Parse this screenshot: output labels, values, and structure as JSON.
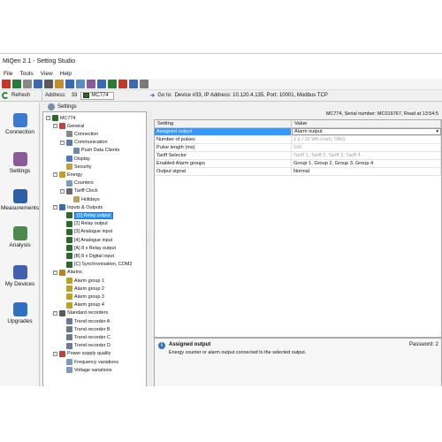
{
  "app": {
    "title": "MiQen 2.1 - Setting Studio"
  },
  "menu": [
    "File",
    "Tools",
    "View",
    "Help"
  ],
  "address_bar": {
    "refresh_label": "Refresh",
    "address_label": "Address:",
    "address_value": "33",
    "device": "MC774",
    "goto_label": "Go to:",
    "goto_target": "Device #33, IP Address: 10.120.4.135, Port: 10001, Modbus TCP"
  },
  "nav": [
    {
      "label": "Connection",
      "icon": "connection-icon",
      "color": "#3b7ad0"
    },
    {
      "label": "Settings",
      "icon": "settings-icon",
      "color": "#8a5a9a"
    },
    {
      "label": "Measurements",
      "icon": "measurements-icon",
      "color": "#2c5fa6"
    },
    {
      "label": "Analysis",
      "icon": "analysis-icon",
      "color": "#4a8a4a"
    },
    {
      "label": "My Devices",
      "icon": "my-devices-icon",
      "color": "#4060b0"
    },
    {
      "label": "Upgrades",
      "icon": "upgrades-icon",
      "color": "#3070c0"
    }
  ],
  "content": {
    "header": "Settings",
    "serial": "MC774, Serial number: MC016767, Read at 13:54:5"
  },
  "tree": [
    {
      "label": "MC774",
      "depth": 0,
      "expander": "-",
      "icon": "device-icon",
      "color": "#2c6a2a"
    },
    {
      "label": "General",
      "depth": 1,
      "expander": "-",
      "icon": "general-icon",
      "color": "#c04040"
    },
    {
      "label": "Connection",
      "depth": 2,
      "expander": "",
      "icon": "connection-icon",
      "color": "#888888"
    },
    {
      "label": "Communication",
      "depth": 2,
      "expander": "-",
      "icon": "communication-icon",
      "color": "#5a7ab0"
    },
    {
      "label": "Push Data Clients",
      "depth": 3,
      "expander": "",
      "icon": "push-data-icon",
      "color": "#6a8ab0"
    },
    {
      "label": "Display",
      "depth": 2,
      "expander": "",
      "icon": "display-icon",
      "color": "#4a7ac0"
    },
    {
      "label": "Security",
      "depth": 2,
      "expander": "",
      "icon": "security-icon",
      "color": "#c0a040"
    },
    {
      "label": "Energy",
      "depth": 1,
      "expander": "-",
      "icon": "energy-icon",
      "color": "#c0a020"
    },
    {
      "label": "Counters",
      "depth": 2,
      "expander": "",
      "icon": "counters-icon",
      "color": "#7a9ac0"
    },
    {
      "label": "Tariff Clock",
      "depth": 2,
      "expander": "-",
      "icon": "tariff-clock-icon",
      "color": "#6a6a6a"
    },
    {
      "label": "Holidays",
      "depth": 3,
      "expander": "",
      "icon": "holidays-icon",
      "color": "#c0a060"
    },
    {
      "label": "Inputs & Outputs",
      "depth": 1,
      "expander": "-",
      "icon": "io-icon",
      "color": "#3a6ab0"
    },
    {
      "label": "[1] Relay output",
      "depth": 2,
      "expander": "",
      "icon": "relay-icon",
      "color": "#2c6a2a",
      "selected": true
    },
    {
      "label": "[2] Relay output",
      "depth": 2,
      "expander": "",
      "icon": "relay-icon",
      "color": "#2c6a2a"
    },
    {
      "label": "[3] Analogue input",
      "depth": 2,
      "expander": "",
      "icon": "analogue-icon",
      "color": "#2c6a2a"
    },
    {
      "label": "[4] Analogue input",
      "depth": 2,
      "expander": "",
      "icon": "analogue-icon",
      "color": "#2c6a2a"
    },
    {
      "label": "[A] 8 x Relay output",
      "depth": 2,
      "expander": "",
      "icon": "relay-icon",
      "color": "#2c6a2a"
    },
    {
      "label": "[B] 8 x Digital input",
      "depth": 2,
      "expander": "",
      "icon": "digital-icon",
      "color": "#2c6a2a"
    },
    {
      "label": "[C] Synchronisation, COM2",
      "depth": 2,
      "expander": "",
      "icon": "sync-icon",
      "color": "#2c6a2a"
    },
    {
      "label": "Alarms",
      "depth": 1,
      "expander": "-",
      "icon": "alarms-icon",
      "color": "#c08020"
    },
    {
      "label": "Alarm group 1",
      "depth": 2,
      "expander": "",
      "icon": "alarm-icon",
      "color": "#c0a020"
    },
    {
      "label": "Alarm group 2",
      "depth": 2,
      "expander": "",
      "icon": "alarm-icon",
      "color": "#c0a020"
    },
    {
      "label": "Alarm group 3",
      "depth": 2,
      "expander": "",
      "icon": "alarm-icon",
      "color": "#c0a020"
    },
    {
      "label": "Alarm group 4",
      "depth": 2,
      "expander": "",
      "icon": "alarm-icon",
      "color": "#c0a020"
    },
    {
      "label": "Standard recorders",
      "depth": 1,
      "expander": "-",
      "icon": "recorders-icon",
      "color": "#5a5a5a"
    },
    {
      "label": "Trend recorder A",
      "depth": 2,
      "expander": "",
      "icon": "trend-icon",
      "color": "#6a7a9a"
    },
    {
      "label": "Trend recorder B",
      "depth": 2,
      "expander": "",
      "icon": "trend-icon",
      "color": "#6a7a9a"
    },
    {
      "label": "Trend recorder C",
      "depth": 2,
      "expander": "",
      "icon": "trend-icon",
      "color": "#6a7a9a"
    },
    {
      "label": "Trend recorder D",
      "depth": 2,
      "expander": "",
      "icon": "trend-icon",
      "color": "#6a7a9a"
    },
    {
      "label": "Power supply quality",
      "depth": 1,
      "expander": "-",
      "icon": "power-quality-icon",
      "color": "#c04040"
    },
    {
      "label": "Frequency variations",
      "depth": 2,
      "expander": "",
      "icon": "frequency-icon",
      "color": "#7a9ac0"
    },
    {
      "label": "Voltage variations",
      "depth": 2,
      "expander": "",
      "icon": "voltage-icon",
      "color": "#7a9ac0"
    }
  ],
  "grid": {
    "headers": [
      "Setting",
      "Value"
    ],
    "rows": [
      {
        "setting": "Assigned output",
        "value": "Alarm output",
        "selected": true,
        "dropdown": true
      },
      {
        "setting": "Number of pulses",
        "value": "1 p / 10 Wh (varh, VAh)",
        "grey": true
      },
      {
        "setting": "Pulse length (ms)",
        "value": "100",
        "grey": true
      },
      {
        "setting": "Tariff Selector",
        "value": "Tariff 1, Tariff 2, Tariff 3, Tariff 4",
        "grey": true
      },
      {
        "setting": "Enabled Alarm groups",
        "value": "Group 1, Group 2, Group 3, Group 4"
      },
      {
        "setting": "Output signal",
        "value": "Normal"
      }
    ]
  },
  "info": {
    "title": "Assigned output",
    "description": "Energy counter or alarm output connected to the selected output.",
    "password": "Password: 2"
  },
  "toolbar_colors": [
    "#c0392b",
    "#2a7a3a",
    "#888888",
    "#3a6ab0",
    "#5a5a5a",
    "#c09030",
    "#3a6ab0",
    "#5a8ac0",
    "#8a5a9a",
    "#3a6ab0",
    "#2a7a3a",
    "#c0392b",
    "#3a6ab0",
    "#7a7a7a"
  ]
}
